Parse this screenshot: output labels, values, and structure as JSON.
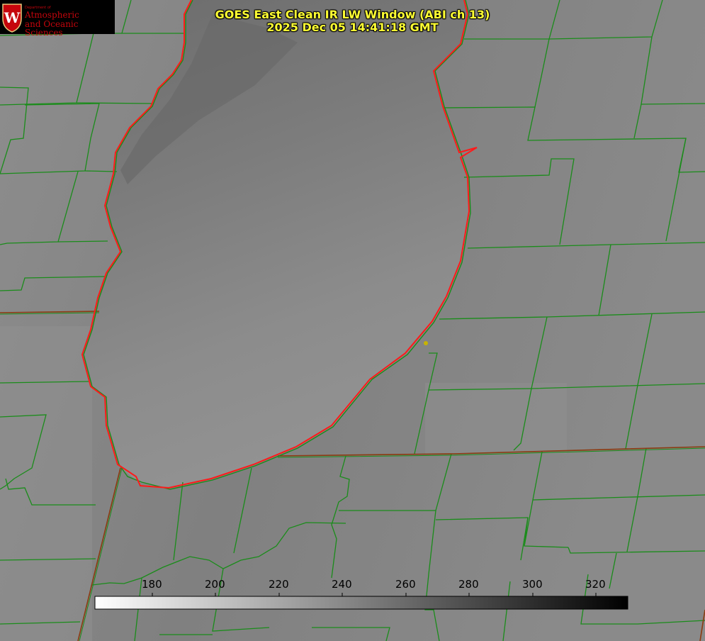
{
  "title": {
    "line1": "GOES East Clean IR LW Window (ABI ch 13)",
    "line2": "2025 Dec 05 14:41:18 GMT"
  },
  "logo": {
    "dept": "Department of",
    "line1": "Atmospheric",
    "line2": "and Oceanic Sciences",
    "crest_letter": "W"
  },
  "colorbar": {
    "ticks": [
      "180",
      "200",
      "220",
      "240",
      "260",
      "280",
      "300",
      "320"
    ],
    "gradient": [
      "#ffffff",
      "#000000"
    ]
  },
  "colors": {
    "county_lines": "#1a8c1a",
    "state_lines": "#8a3a10",
    "lake_outline": "#ff1a1a",
    "marker": "#c8b400",
    "title_text": "#ffff33",
    "logo_red": "#c5050c"
  }
}
